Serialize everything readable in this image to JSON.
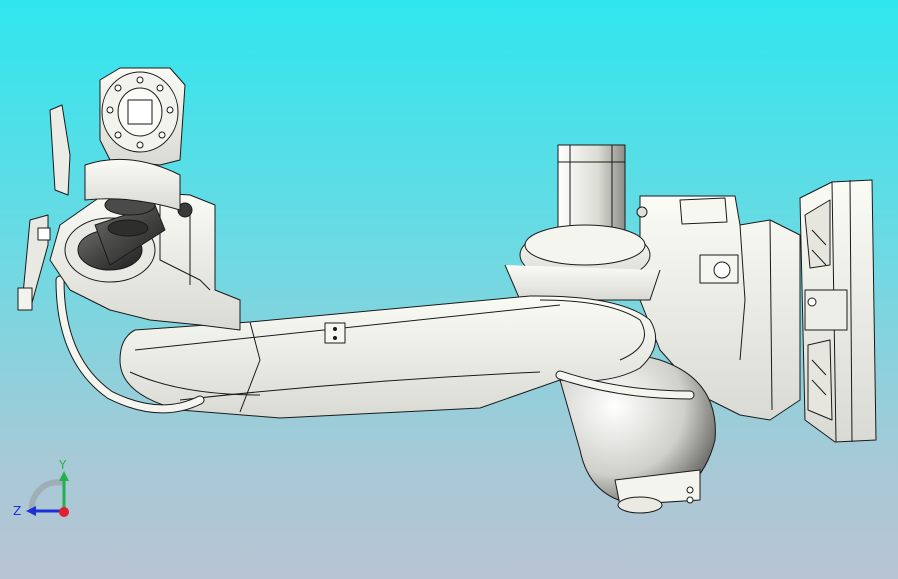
{
  "viewport": {
    "background_top": "#2fe6ee",
    "background_bottom": "#b8c4d4"
  },
  "model": {
    "body_color": "#f2f2ec",
    "shade_color": "#c9cbc4",
    "dark_color": "#3a3a3a",
    "edge_color": "#1a1a1a"
  },
  "triad": {
    "y_label": "Y",
    "z_label": "Z",
    "y_color": "#22b14c",
    "z_color": "#1f2fd8",
    "origin_color": "#e0202a"
  }
}
